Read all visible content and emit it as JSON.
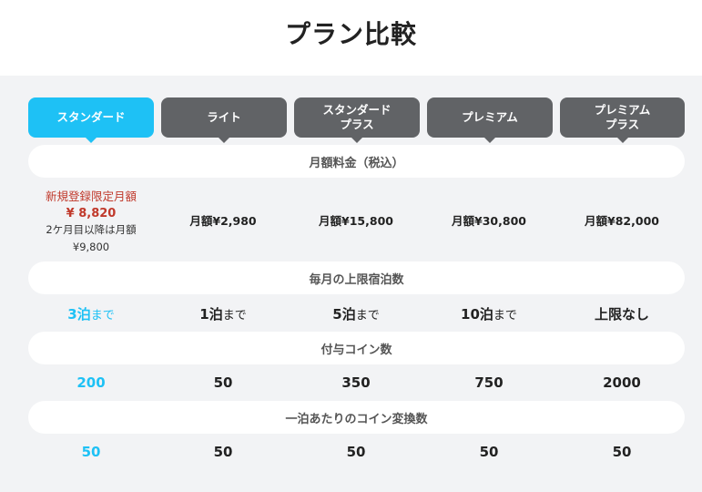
{
  "page": {
    "title": "プラン比較"
  },
  "tabs": [
    {
      "label": "スタンダード",
      "active": true
    },
    {
      "label": "ライト",
      "active": false
    },
    {
      "label": "スタンダード\nプラス",
      "active": false
    },
    {
      "label": "プレミアム",
      "active": false
    },
    {
      "label": "プレミアム\nプラス",
      "active": false
    }
  ],
  "sections": {
    "monthly_fee": "月額料金（税込）",
    "nights": "毎月の上限宿泊数",
    "coins": "付与コイン数",
    "conversion": "一泊あたりのコイン変換数"
  },
  "monthly_fee": {
    "standard": {
      "promo_label": "新規登録限定月額",
      "promo_price": "¥ 8,820",
      "after_note": "2ケ月目以降は月額",
      "after_price": "¥9,800"
    },
    "others": [
      "月額¥2,980",
      "月額¥15,800",
      "月額¥30,800",
      "月額¥82,000"
    ]
  },
  "nights": [
    {
      "value": "3泊",
      "unit": "まで"
    },
    {
      "value": "1泊",
      "unit": "まで"
    },
    {
      "value": "5泊",
      "unit": "まで"
    },
    {
      "value": "10泊",
      "unit": "まで"
    },
    {
      "value": "上限なし",
      "unit": ""
    }
  ],
  "coins": [
    "200",
    "50",
    "350",
    "750",
    "2000"
  ],
  "conversion": [
    "50",
    "50",
    "50",
    "50",
    "50"
  ],
  "colors": {
    "accent": "#1ec1f5",
    "tab_inactive": "#616366",
    "promo": "#c0392b",
    "panel_bg": "#f2f3f5"
  }
}
